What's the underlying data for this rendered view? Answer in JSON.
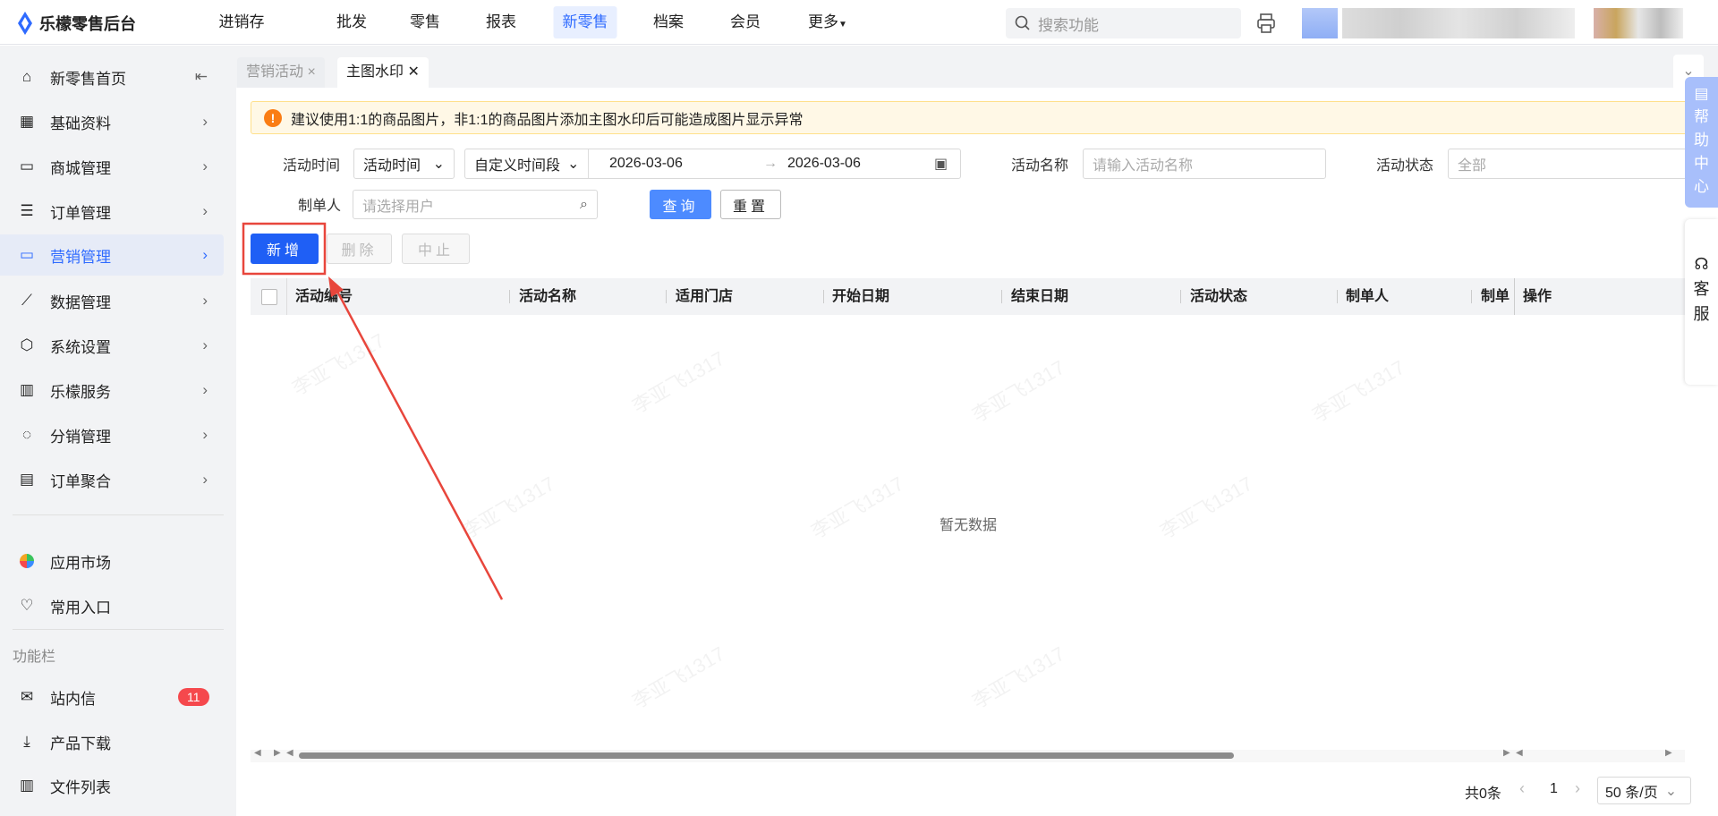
{
  "app": {
    "title": "乐檬零售后台"
  },
  "nav": [
    {
      "label": "进销存"
    },
    {
      "label": "批发"
    },
    {
      "label": "零售"
    },
    {
      "label": "报表"
    },
    {
      "label": "新零售"
    },
    {
      "label": "档案"
    },
    {
      "label": "会员"
    },
    {
      "label": "更多"
    }
  ],
  "search": {
    "placeholder": "搜索功能"
  },
  "sidebar": {
    "items": [
      {
        "label": "新零售首页"
      },
      {
        "label": "基础资料"
      },
      {
        "label": "商城管理"
      },
      {
        "label": "订单管理"
      },
      {
        "label": "营销管理"
      },
      {
        "label": "数据管理"
      },
      {
        "label": "系统设置"
      },
      {
        "label": "乐檬服务"
      },
      {
        "label": "分销管理"
      },
      {
        "label": "订单聚合"
      }
    ],
    "apps": [
      {
        "label": "应用市场"
      },
      {
        "label": "常用入口"
      }
    ],
    "section": "功能栏",
    "tools": [
      {
        "label": "站内信",
        "badge": "11"
      },
      {
        "label": "产品下载"
      },
      {
        "label": "文件列表"
      }
    ]
  },
  "tabs": [
    {
      "label": "营销活动",
      "close": "×"
    },
    {
      "label": "主图水印",
      "close": "✕"
    }
  ],
  "alert": {
    "text": "建议使用1:1的商品图片，非1:1的商品图片添加主图水印后可能造成图片显示异常",
    "icon": "!"
  },
  "filters": {
    "time_label": "活动时间",
    "time_type": "活动时间",
    "range_type": "自定义时间段",
    "start": "2026-03-06",
    "end": "2026-03-06",
    "name_label": "活动名称",
    "name_placeholder": "请输入活动名称",
    "status_label": "活动状态",
    "status_value": "全部",
    "creator_label": "制单人",
    "creator_placeholder": "请选择用户",
    "query": "查询",
    "reset": "重置"
  },
  "actions": {
    "add": "新增",
    "delete": "删除",
    "stop": "中止"
  },
  "table": {
    "columns": [
      "活动编号",
      "活动名称",
      "适用门店",
      "开始日期",
      "结束日期",
      "活动状态",
      "制单人",
      "制单",
      "操作"
    ],
    "empty": "暂无数据"
  },
  "pagination": {
    "total": "共0条",
    "page": "1",
    "size": "50 条/页"
  },
  "float": {
    "help": [
      "帮",
      "助",
      "中",
      "心"
    ],
    "service": [
      "客",
      "服"
    ]
  },
  "watermark": "李亚飞1317",
  "colors": {
    "primary": "#2f6bff",
    "badge": "#f5484d",
    "annotation": "#e8463c"
  }
}
